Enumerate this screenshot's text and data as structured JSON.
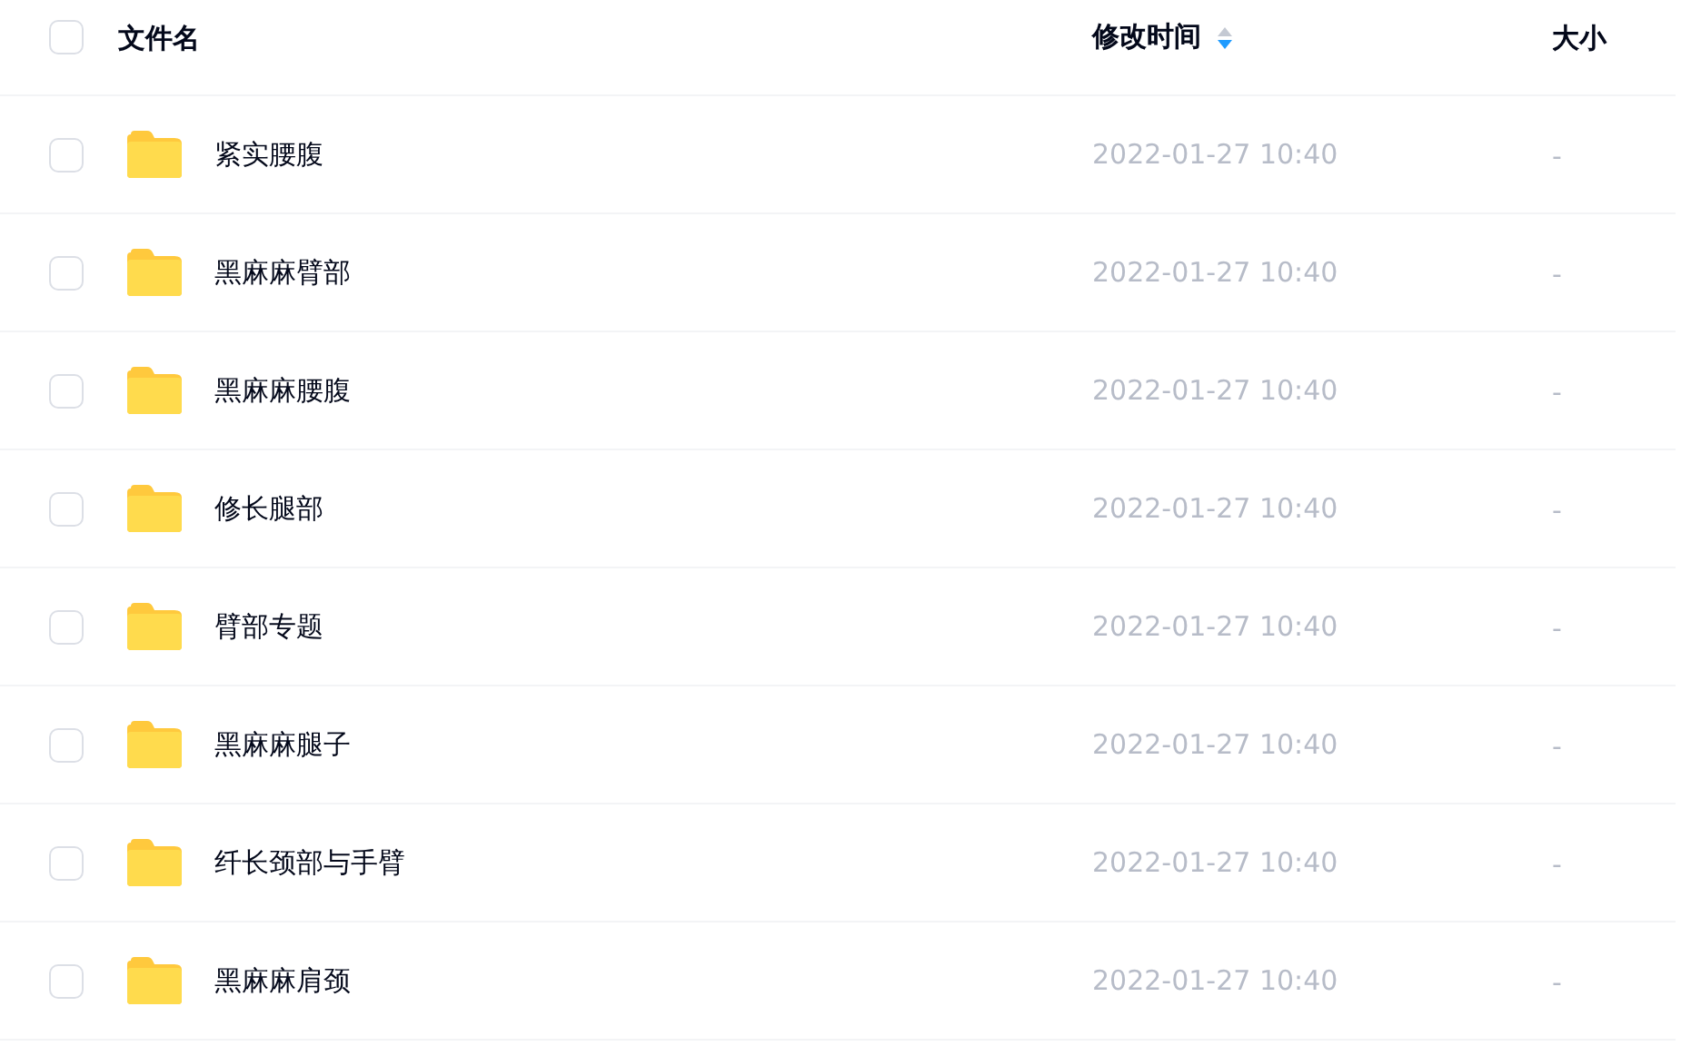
{
  "table": {
    "select_all": {
      "checked": false
    },
    "columns": [
      {
        "label": "文件名",
        "kind": "plain"
      },
      {
        "label": "修改时间",
        "kind": "sortable",
        "sort_descending": true
      },
      {
        "label": "大小",
        "kind": "plain"
      }
    ],
    "rows": [
      {
        "name": "紧实腰腹",
        "modified": "2022-01-27 10:40",
        "size": "-",
        "checked": false
      },
      {
        "name": "黑麻麻臂部",
        "modified": "2022-01-27 10:40",
        "size": "-",
        "checked": false
      },
      {
        "name": "黑麻麻腰腹",
        "modified": "2022-01-27 10:40",
        "size": "-",
        "checked": false
      },
      {
        "name": "修长腿部",
        "modified": "2022-01-27 10:40",
        "size": "-",
        "checked": false
      },
      {
        "name": "臂部专题",
        "modified": "2022-01-27 10:40",
        "size": "-",
        "checked": false
      },
      {
        "name": "黑麻麻腿子",
        "modified": "2022-01-27 10:40",
        "size": "-",
        "checked": false
      },
      {
        "name": "纤长颈部与手臂",
        "modified": "2022-01-27 10:40",
        "size": "-",
        "checked": false
      },
      {
        "name": "黑麻麻肩颈",
        "modified": "2022-01-27 10:40",
        "size": "-",
        "checked": false
      }
    ]
  }
}
